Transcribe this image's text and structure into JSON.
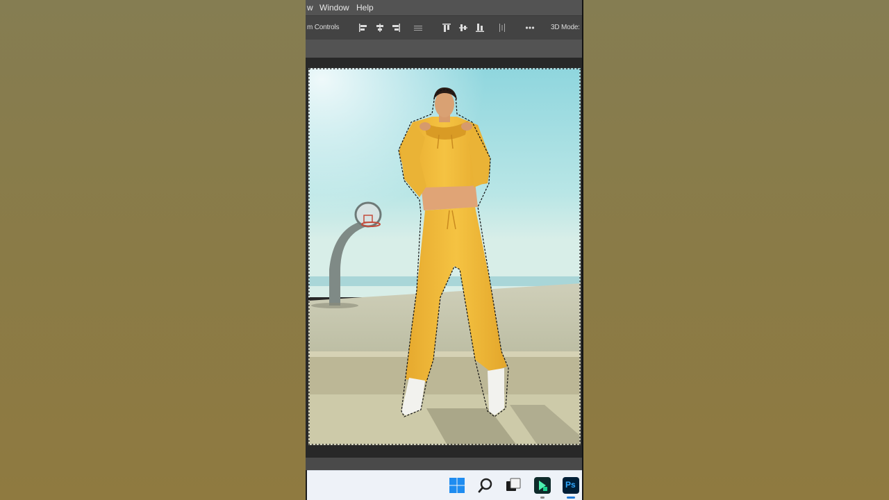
{
  "menubar": {
    "item_view_partial": "w",
    "item_window": "Window",
    "item_help": "Help"
  },
  "options_bar": {
    "transform_controls_partial": "m Controls",
    "mode_3d_partial": "3D Mode:"
  },
  "document": {
    "image_subject": "woman in yellow tracksuit beside basketball hoop",
    "selection": "marching-ants outline around person and full-canvas marquee"
  },
  "taskbar": {
    "icons": [
      "windows-start-icon",
      "search-icon",
      "task-view-icon",
      "filmora-icon",
      "photoshop-icon"
    ],
    "photoshop_label": "Ps",
    "active_app": "photoshop"
  },
  "colors": {
    "sky": "#a9dfe3",
    "tracksuit": "#f0b83a",
    "ground": "#c9c8ae",
    "ps_blue": "#31a8ff"
  }
}
